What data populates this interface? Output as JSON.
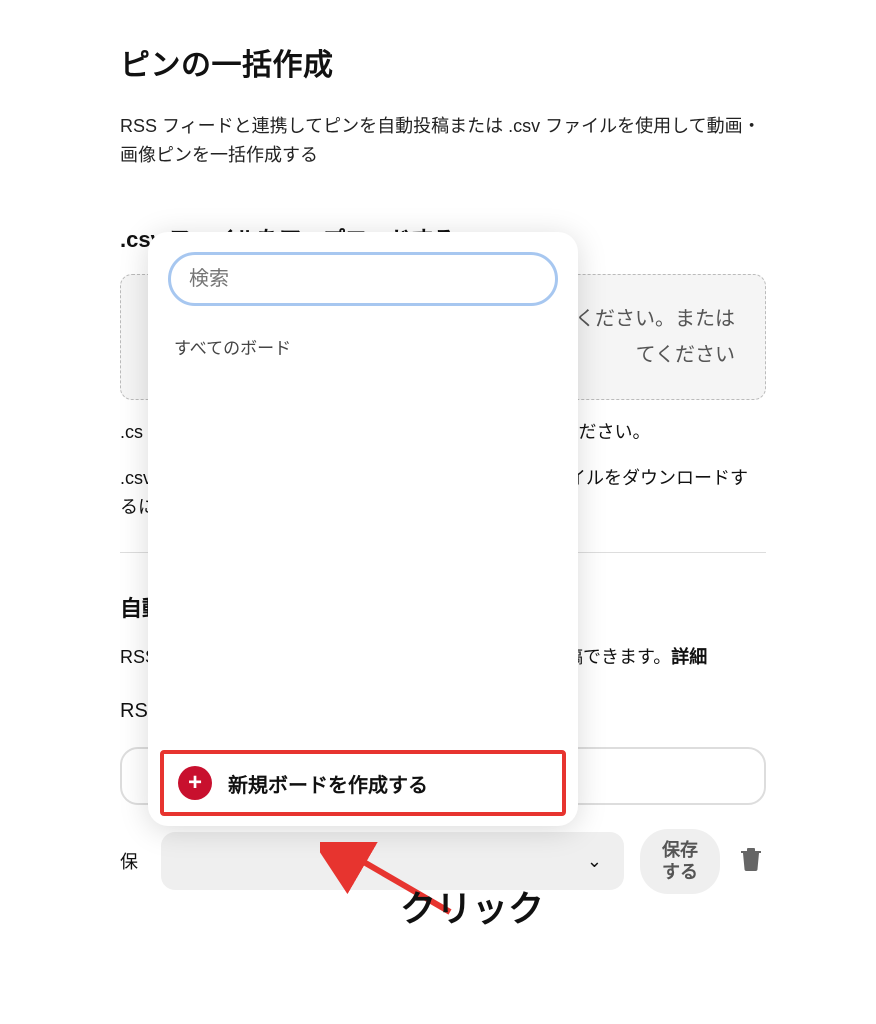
{
  "page": {
    "title": "ピンの一括作成",
    "description": "RSS フィードと連携してピンを自動投稿または .csv ファイルを使用して動画・画像ピンを一括作成する",
    "section1_title_prefix": ".csv",
    "section1_title_rest": "ファイルをアップロードする",
    "upload_line1": "ください。または",
    "upload_line2": "てください",
    "csv_prefix1": ".cs",
    "hint1_suffix": "てください。",
    "csv_prefix2": ".csv",
    "hint2_suffix": "ファイルをダウンロードす",
    "hint2_tail": "るに",
    "section2_title": "自動",
    "rss_prefix": "RSS",
    "rss_desc_tail": "投稿できます。",
    "rss_desc_bold": "詳細",
    "rss_label": "RSS",
    "save_label": "保",
    "save_btn": "保存する",
    "trash_glyph": "🗑"
  },
  "popup": {
    "search_placeholder": "検索",
    "all_boards": "すべてのボード",
    "create_board": "新規ボードを作成する",
    "plus": "+"
  },
  "annotation": {
    "click": "クリック"
  },
  "chevron": "⌄"
}
